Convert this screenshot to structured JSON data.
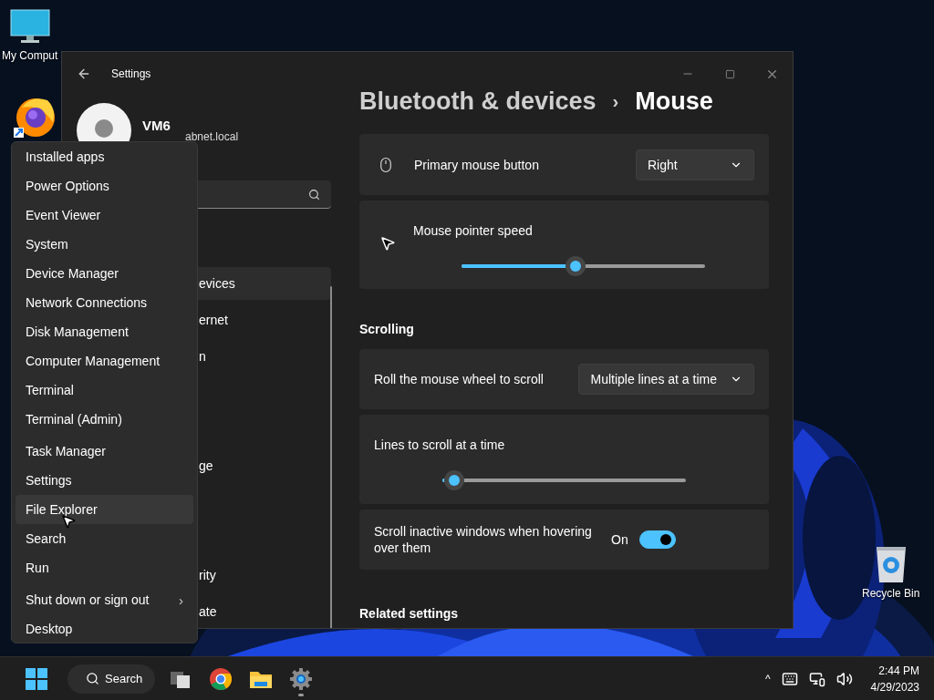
{
  "desktop": {
    "icons": [
      {
        "kind": "computer",
        "label": "My Comput"
      },
      {
        "kind": "browser"
      },
      {
        "kind": "recycle_bin",
        "label": "Recycle Bin"
      }
    ]
  },
  "settings_window": {
    "title": "Settings",
    "account": {
      "name": "VM6",
      "email": "abnet.local"
    },
    "nav_items": [
      {
        "label": "evices",
        "selected": true
      },
      {
        "label": "ernet",
        "selected": false
      },
      {
        "label": "n",
        "selected": false
      },
      {
        "label": "ge",
        "selected": false
      },
      {
        "label": "rity",
        "selected": false
      },
      {
        "label": "ate",
        "selected": false
      }
    ],
    "breadcrumb": {
      "parent": "Bluetooth & devices",
      "separator": "›",
      "current": "Mouse"
    },
    "mouse_cards": [
      {
        "kind": "dropdown",
        "label": "Primary mouse button",
        "value": "Right"
      },
      {
        "kind": "slider",
        "label": "Mouse pointer speed",
        "level": 0.47
      }
    ],
    "scrolling": {
      "heading": "Scrolling",
      "cards": [
        {
          "kind": "dropdown",
          "label": "Roll the mouse wheel to scroll",
          "value": "Multiple lines at a time"
        },
        {
          "kind": "slider",
          "label": "Lines to scroll at a time",
          "level": 0.05
        },
        {
          "kind": "toggle",
          "label": "Scroll inactive windows when hovering over them",
          "state_text": "On",
          "on": true
        }
      ]
    },
    "next_heading": "Related settings"
  },
  "context_menu": {
    "groups": [
      [
        {
          "label": "Installed apps",
          "selected": false
        },
        {
          "label": "Power Options",
          "selected": false
        },
        {
          "label": "Event Viewer",
          "selected": false
        },
        {
          "label": "System",
          "selected": false
        },
        {
          "label": "Device Manager",
          "selected": false
        },
        {
          "label": "Network Connections",
          "selected": false
        },
        {
          "label": "Disk Management",
          "selected": false
        },
        {
          "label": "Computer Management",
          "selected": false
        },
        {
          "label": "Terminal",
          "selected": false
        },
        {
          "label": "Terminal (Admin)",
          "selected": false
        }
      ],
      [
        {
          "label": "Task Manager",
          "selected": false
        },
        {
          "label": "Settings",
          "selected": false
        },
        {
          "label": "File Explorer",
          "selected": true
        },
        {
          "label": "Search",
          "selected": false
        },
        {
          "label": "Run",
          "selected": false
        }
      ],
      [
        {
          "label": "Shut down or sign out",
          "selected": false,
          "arrow": "›"
        },
        {
          "label": "Desktop",
          "selected": false
        }
      ]
    ]
  },
  "taskbar": {
    "search_label": "Search",
    "apps": [
      {
        "kind": "task_view",
        "running": false
      },
      {
        "kind": "chrome",
        "running": false
      },
      {
        "kind": "folder",
        "running": false
      },
      {
        "kind": "settings",
        "running": true
      }
    ],
    "tray": {
      "overflow": "^",
      "time": "2:44 PM",
      "date": "4/29/2023"
    }
  }
}
